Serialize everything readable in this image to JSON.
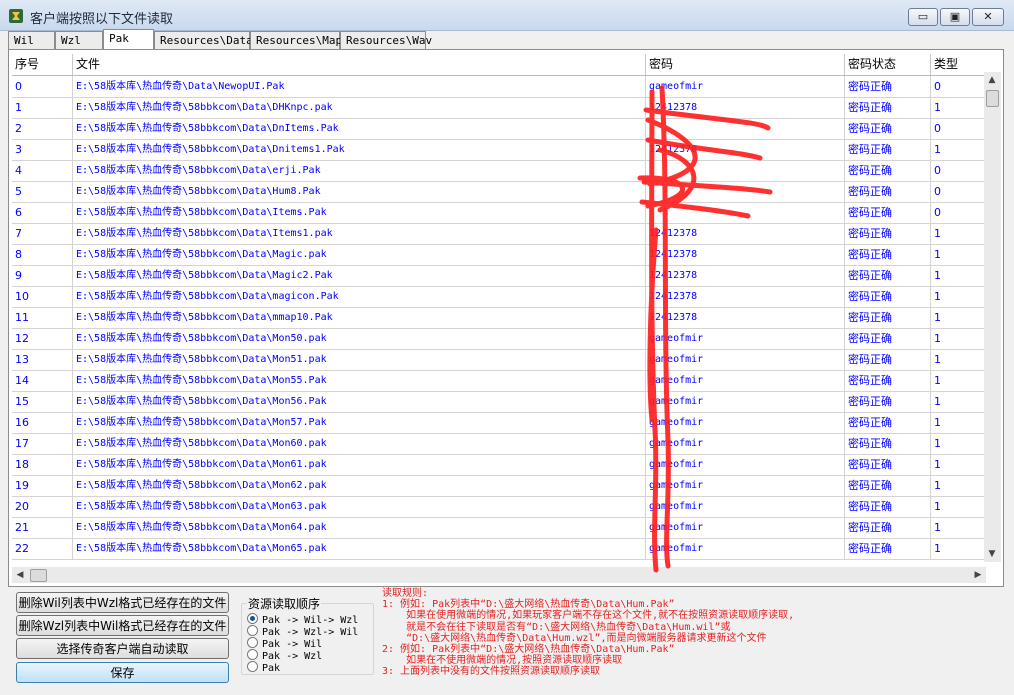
{
  "window": {
    "title": "客户端按照以下文件读取",
    "min_glyph": "▭",
    "max_glyph": "▣",
    "close_glyph": "✕"
  },
  "tabs": [
    {
      "label": "Wil"
    },
    {
      "label": "Wzl"
    },
    {
      "label": "Pak"
    },
    {
      "label": "Resources\\Data"
    },
    {
      "label": "Resources\\Map"
    },
    {
      "label": "Resources\\Wav"
    }
  ],
  "grid": {
    "columns": [
      "序号",
      "文件",
      "密码",
      "密码状态",
      "类型"
    ],
    "rows": [
      {
        "idx": "0",
        "file": "E:\\58版本库\\热血传奇\\Data\\NewopUI.Pak",
        "pwd": "gameofmir",
        "status": "密码正确",
        "type": "0"
      },
      {
        "idx": "1",
        "file": "E:\\58版本库\\热血传奇\\58bbkcom\\Data\\DHKnpc.pak",
        "pwd": "12412378",
        "status": "密码正确",
        "type": "1"
      },
      {
        "idx": "2",
        "file": "E:\\58版本库\\热血传奇\\58bbkcom\\Data\\DnItems.Pak",
        "pwd": "",
        "status": "密码正确",
        "type": "0"
      },
      {
        "idx": "3",
        "file": "E:\\58版本库\\热血传奇\\58bbkcom\\Data\\Dnitems1.Pak",
        "pwd": "12412378",
        "status": "密码正确",
        "type": "1"
      },
      {
        "idx": "4",
        "file": "E:\\58版本库\\热血传奇\\58bbkcom\\Data\\erji.Pak",
        "pwd": "",
        "status": "密码正确",
        "type": "0"
      },
      {
        "idx": "5",
        "file": "E:\\58版本库\\热血传奇\\58bbkcom\\Data\\Hum8.Pak",
        "pwd": "",
        "status": "密码正确",
        "type": "0"
      },
      {
        "idx": "6",
        "file": "E:\\58版本库\\热血传奇\\58bbkcom\\Data\\Items.Pak",
        "pwd": "",
        "status": "密码正确",
        "type": "0"
      },
      {
        "idx": "7",
        "file": "E:\\58版本库\\热血传奇\\58bbkcom\\Data\\Items1.pak",
        "pwd": "12412378",
        "status": "密码正确",
        "type": "1"
      },
      {
        "idx": "8",
        "file": "E:\\58版本库\\热血传奇\\58bbkcom\\Data\\Magic.pak",
        "pwd": "12412378",
        "status": "密码正确",
        "type": "1"
      },
      {
        "idx": "9",
        "file": "E:\\58版本库\\热血传奇\\58bbkcom\\Data\\Magic2.Pak",
        "pwd": "12412378",
        "status": "密码正确",
        "type": "1"
      },
      {
        "idx": "10",
        "file": "E:\\58版本库\\热血传奇\\58bbkcom\\Data\\magicon.Pak",
        "pwd": "12412378",
        "status": "密码正确",
        "type": "1"
      },
      {
        "idx": "11",
        "file": "E:\\58版本库\\热血传奇\\58bbkcom\\Data\\mmap10.Pak",
        "pwd": "12412378",
        "status": "密码正确",
        "type": "1"
      },
      {
        "idx": "12",
        "file": "E:\\58版本库\\热血传奇\\58bbkcom\\Data\\Mon50.pak",
        "pwd": "gameofmir",
        "status": "密码正确",
        "type": "1"
      },
      {
        "idx": "13",
        "file": "E:\\58版本库\\热血传奇\\58bbkcom\\Data\\Mon51.pak",
        "pwd": "gameofmir",
        "status": "密码正确",
        "type": "1"
      },
      {
        "idx": "14",
        "file": "E:\\58版本库\\热血传奇\\58bbkcom\\Data\\Mon55.Pak",
        "pwd": "gameofmir",
        "status": "密码正确",
        "type": "1"
      },
      {
        "idx": "15",
        "file": "E:\\58版本库\\热血传奇\\58bbkcom\\Data\\Mon56.Pak",
        "pwd": "gameofmir",
        "status": "密码正确",
        "type": "1"
      },
      {
        "idx": "16",
        "file": "E:\\58版本库\\热血传奇\\58bbkcom\\Data\\Mon57.Pak",
        "pwd": "gameofmir",
        "status": "密码正确",
        "type": "1"
      },
      {
        "idx": "17",
        "file": "E:\\58版本库\\热血传奇\\58bbkcom\\Data\\Mon60.pak",
        "pwd": "gameofmir",
        "status": "密码正确",
        "type": "1"
      },
      {
        "idx": "18",
        "file": "E:\\58版本库\\热血传奇\\58bbkcom\\Data\\Mon61.pak",
        "pwd": "gameofmir",
        "status": "密码正确",
        "type": "1"
      },
      {
        "idx": "19",
        "file": "E:\\58版本库\\热血传奇\\58bbkcom\\Data\\Mon62.pak",
        "pwd": "gameofmir",
        "status": "密码正确",
        "type": "1"
      },
      {
        "idx": "20",
        "file": "E:\\58版本库\\热血传奇\\58bbkcom\\Data\\Mon63.pak",
        "pwd": "gameofmir",
        "status": "密码正确",
        "type": "1"
      },
      {
        "idx": "21",
        "file": "E:\\58版本库\\热血传奇\\58bbkcom\\Data\\Mon64.pak",
        "pwd": "gameofmir",
        "status": "密码正确",
        "type": "1"
      },
      {
        "idx": "22",
        "file": "E:\\58版本库\\热血传奇\\58bbkcom\\Data\\Mon65.pak",
        "pwd": "gameofmir",
        "status": "密码正确",
        "type": "1"
      }
    ]
  },
  "scroll": {
    "up": "▲",
    "down": "▼",
    "left": "◀",
    "right": "▶"
  },
  "buttons": {
    "delete_wil": "删除Wil列表中Wzl格式已经存在的文件",
    "delete_wzl": "删除Wzl列表中Wil格式已经存在的文件",
    "select_client": "选择传奇客户端自动读取",
    "save": "保存"
  },
  "read_order": {
    "legend": "资源读取顺序",
    "options": [
      "Pak -> Wil-> Wzl",
      "Pak -> Wzl-> Wil",
      "Pak -> Wil",
      "Pak -> Wzl",
      "Pak"
    ],
    "selected_index": 0
  },
  "rules": [
    "读取规则:",
    "1: 例如: Pak列表中“D:\\盛大网络\\热血传奇\\Data\\Hum.Pak”",
    "    如果在使用微端的情况,如果玩家客户端不存在这个文件,就不在按照资源读取顺序读取,",
    "    就是不会在往下读取是否有“D:\\盛大网络\\热血传奇\\Data\\Hum.wil”或",
    "    “D:\\盛大网络\\热血传奇\\Data\\Hum.wzl”,而是向微端服务器请求更新这个文件",
    "2: 例如: Pak列表中“D:\\盛大网络\\热血传奇\\Data\\Hum.Pak”",
    "    如果在不使用微端的情况,按照资源读取顺序读取",
    "3: 上面列表中没有的文件按照资源读取顺序读取"
  ],
  "colors": {
    "link_text": "#0000ff",
    "rules_text": "#e52222",
    "annotation": "#ff1f1f"
  }
}
